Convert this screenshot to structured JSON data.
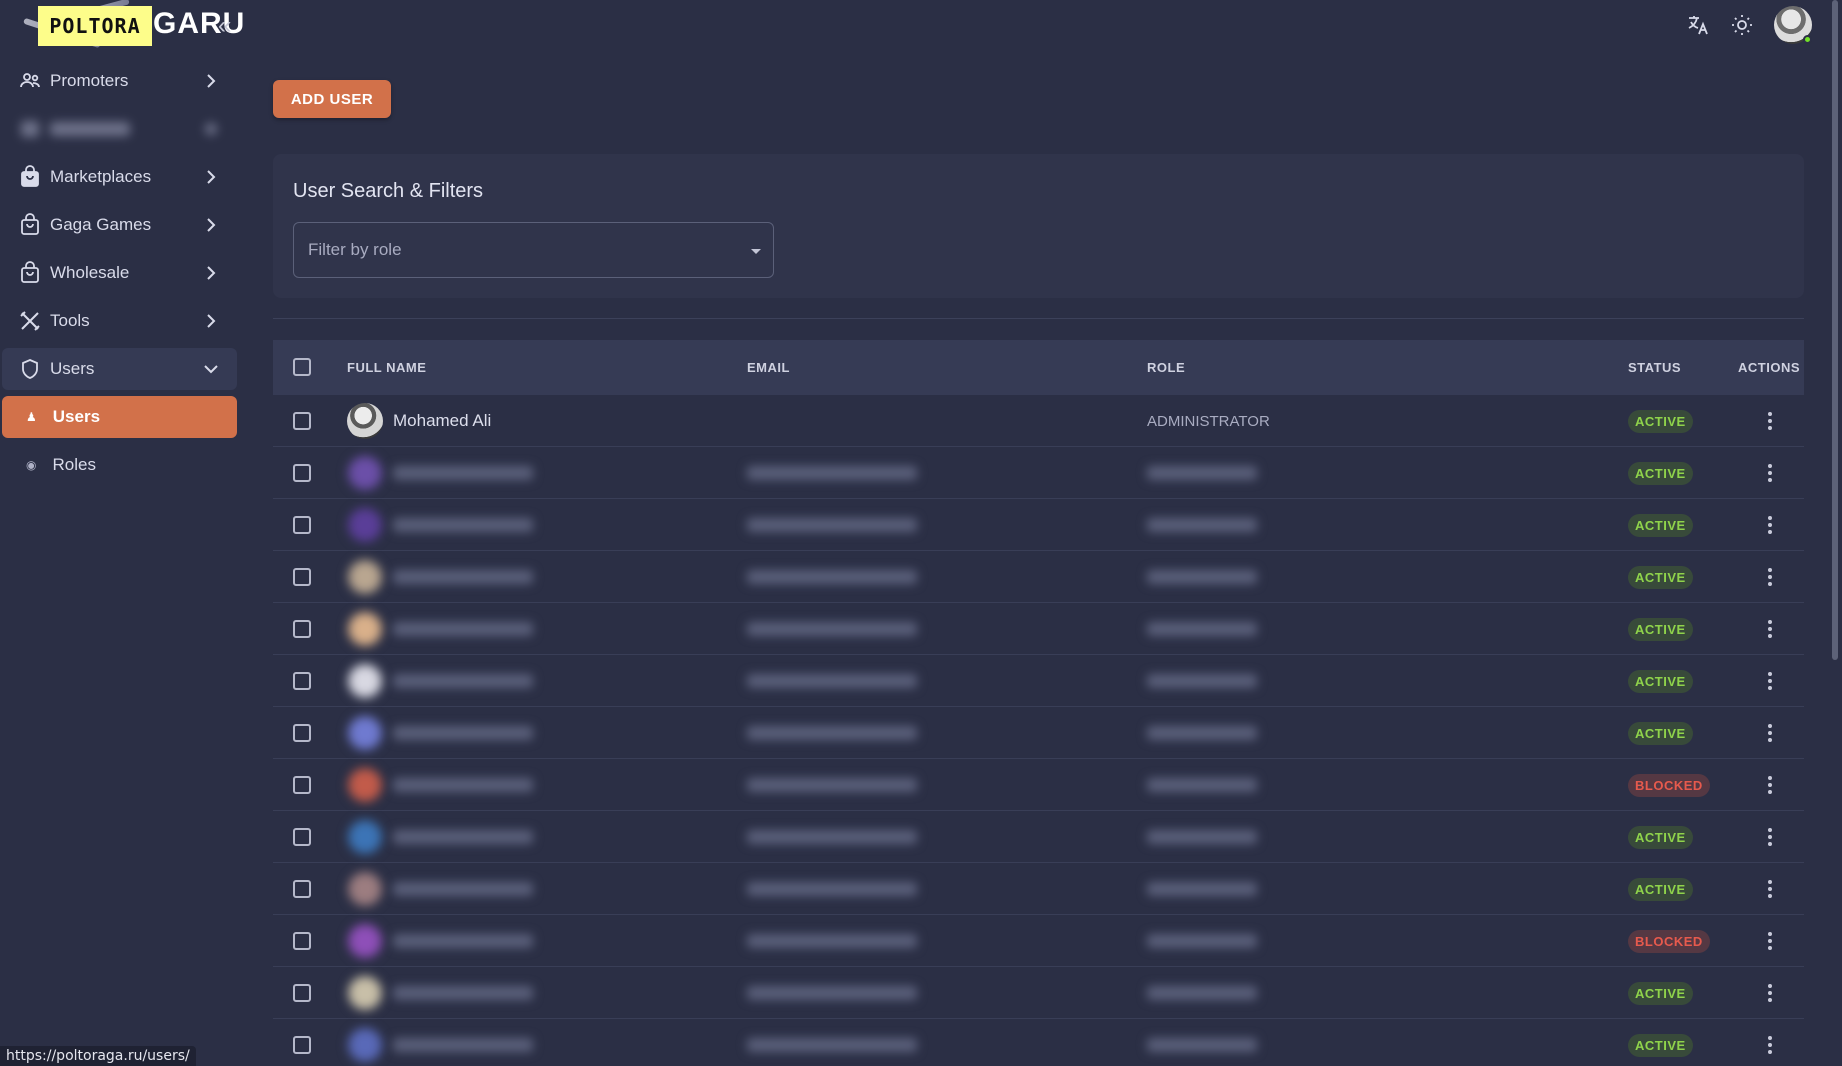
{
  "logo": {
    "badge": "POLTORA",
    "tail": "GARU",
    "collapse_icon": "«"
  },
  "sidebar": {
    "items": [
      {
        "label": "Promoters",
        "icon": "users-group-icon"
      },
      {
        "label": "",
        "icon": "blurred-icon",
        "blurred": true
      },
      {
        "label": "Marketplaces",
        "icon": "shopping-bag-icon"
      },
      {
        "label": "Gaga Games",
        "icon": "shopping-bag-icon"
      },
      {
        "label": "Wholesale",
        "icon": "shopping-bag-icon"
      },
      {
        "label": "Tools",
        "icon": "tools-icon"
      },
      {
        "label": "Users",
        "icon": "shield-icon",
        "open": true
      }
    ],
    "subitems": [
      {
        "label": "Users",
        "active": true
      },
      {
        "label": "Roles",
        "active": false
      }
    ]
  },
  "top": {
    "translate_icon": "translate-icon",
    "theme_icon": "sun-icon"
  },
  "main": {
    "add_user_label": "ADD USER",
    "filters_title": "User Search & Filters",
    "role_placeholder": "Filter by role"
  },
  "table": {
    "headers": {
      "name": "FULL NAME",
      "email": "EMAIL",
      "role": "ROLE",
      "status": "STATUS",
      "actions": "ACTIONS"
    },
    "rows": [
      {
        "name": "Mohamed Ali",
        "email": "",
        "role": "ADMINISTRATOR",
        "status": "ACTIVE",
        "avatar_color": "#cfcfcf"
      },
      {
        "name": "",
        "email": "",
        "role": "",
        "status": "ACTIVE",
        "avatar_color": "#6b4fa8"
      },
      {
        "name": "",
        "email": "",
        "role": "",
        "status": "ACTIVE",
        "avatar_color": "#5a3e98"
      },
      {
        "name": "",
        "email": "",
        "role": "",
        "status": "ACTIVE",
        "avatar_color": "#b9a690"
      },
      {
        "name": "",
        "email": "",
        "role": "",
        "status": "ACTIVE",
        "avatar_color": "#d9b08a"
      },
      {
        "name": "",
        "email": "",
        "role": "",
        "status": "ACTIVE",
        "avatar_color": "#d8d8e2"
      },
      {
        "name": "",
        "email": "",
        "role": "",
        "status": "ACTIVE",
        "avatar_color": "#6f7ad0"
      },
      {
        "name": "",
        "email": "",
        "role": "",
        "status": "BLOCKED",
        "avatar_color": "#c25b4a"
      },
      {
        "name": "",
        "email": "",
        "role": "",
        "status": "ACTIVE",
        "avatar_color": "#3c74b6"
      },
      {
        "name": "",
        "email": "",
        "role": "",
        "status": "ACTIVE",
        "avatar_color": "#9c7d80"
      },
      {
        "name": "",
        "email": "",
        "role": "",
        "status": "BLOCKED",
        "avatar_color": "#8e4fb8"
      },
      {
        "name": "",
        "email": "",
        "role": "",
        "status": "ACTIVE",
        "avatar_color": "#c8bfa8"
      },
      {
        "name": "",
        "email": "",
        "role": "",
        "status": "ACTIVE",
        "avatar_color": "#5969b8"
      }
    ]
  },
  "status_bar_url": "https://poltoraga.ru/users/"
}
